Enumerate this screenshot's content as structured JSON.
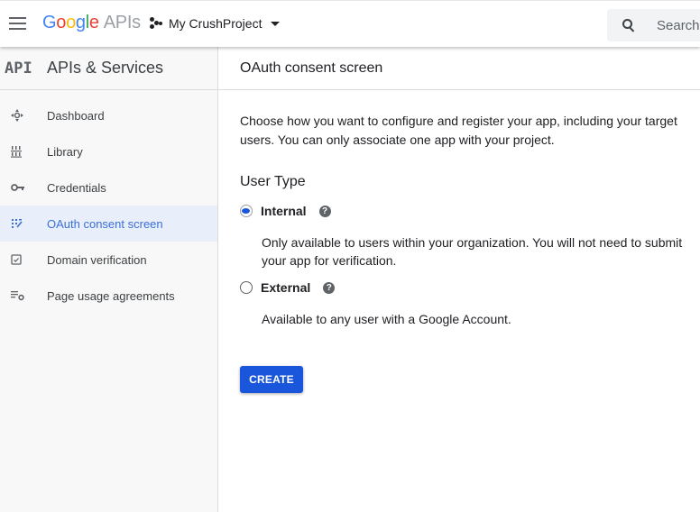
{
  "topbar": {
    "menu_icon": "hamburger-menu-icon",
    "logo": {
      "google": "Google",
      "product": "APIs"
    },
    "project": {
      "icon": "project-dots-icon",
      "name": "My CrushProject",
      "dropdown_icon": "caret-down-icon"
    },
    "search": {
      "icon": "search-icon",
      "placeholder": "Search"
    }
  },
  "sidebar": {
    "badge": "API",
    "title": "APIs & Services",
    "items": [
      {
        "label": "Dashboard",
        "icon": "dashboard-icon",
        "active": false
      },
      {
        "label": "Library",
        "icon": "library-icon",
        "active": false
      },
      {
        "label": "Credentials",
        "icon": "key-icon",
        "active": false
      },
      {
        "label": "OAuth consent screen",
        "icon": "oauth-consent-icon",
        "active": true
      },
      {
        "label": "Domain verification",
        "icon": "domain-verification-icon",
        "active": false
      },
      {
        "label": "Page usage agreements",
        "icon": "page-usage-settings-icon",
        "active": false
      }
    ]
  },
  "main": {
    "title": "OAuth consent screen",
    "intro": "Choose how you want to configure and register your app, including your target users. You can only associate one app with your project.",
    "user_type": {
      "heading": "User Type",
      "selected": "internal",
      "options": [
        {
          "id": "internal",
          "label": "Internal",
          "description": "Only available to users within your organization. You will not need to submit your app for verification.",
          "help_icon": "help-icon"
        },
        {
          "id": "external",
          "label": "External",
          "description": "Available to any user with a Google Account.",
          "help_icon": "help-icon"
        }
      ]
    },
    "create_label": "CREATE"
  },
  "colors": {
    "accent": "#1a56db",
    "active_nav_bg": "#e8eefa",
    "active_nav_text": "#3b6fd8"
  }
}
